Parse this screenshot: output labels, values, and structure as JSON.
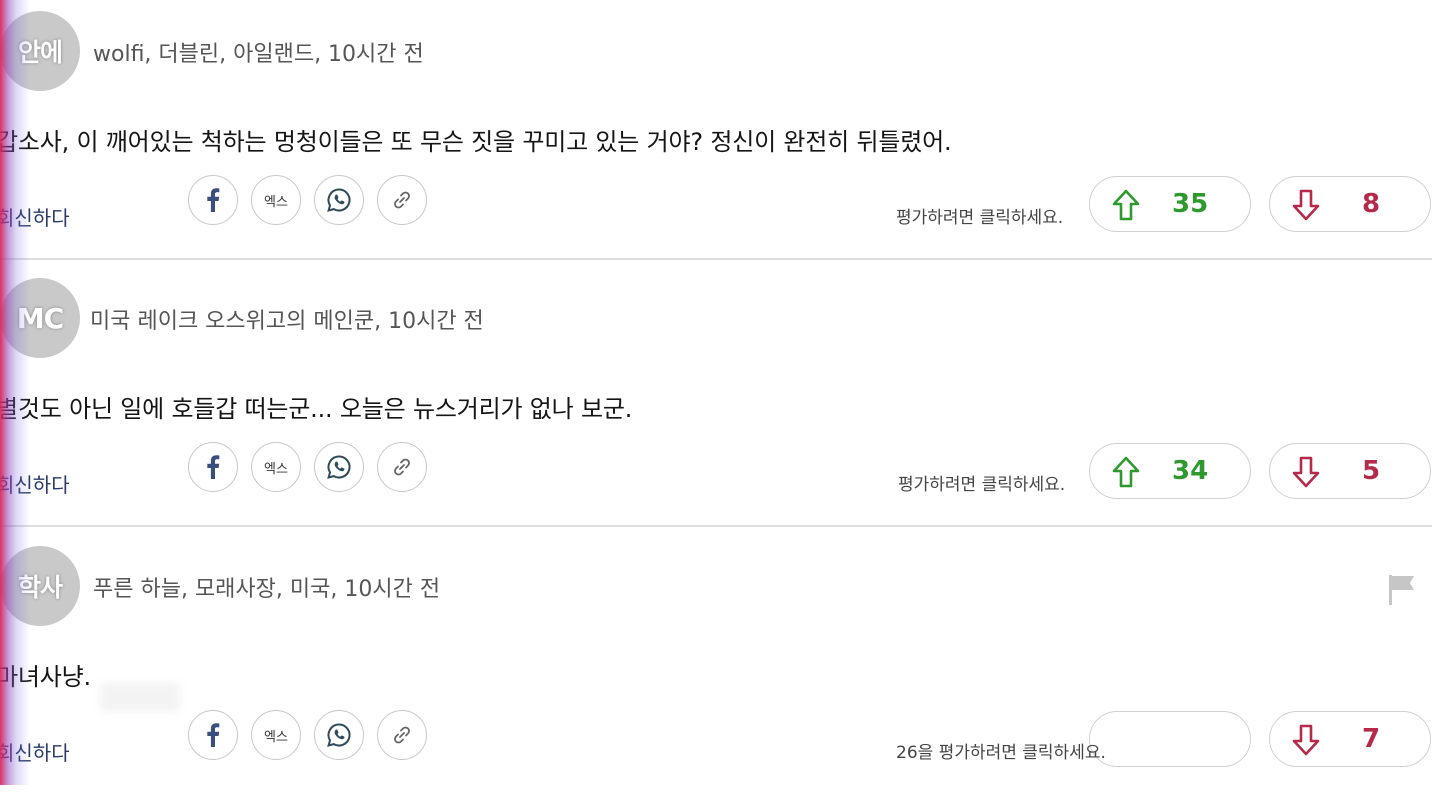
{
  "comments": [
    {
      "avatar": "안에",
      "meta": "wolfi, 더블린, 아일랜드, 10시간 전",
      "body": "갑소사, 이 깨어있는 척하는 멍청이들은 또 무슨 짓을 꾸미고 있는 거야? 정신이 완전히 뒤틀렸어.",
      "reply": "회신하다",
      "rate_label": "평가하려면 클릭하세요.",
      "upvotes": "35",
      "downvotes": "8"
    },
    {
      "avatar": "MC",
      "meta": "미국 레이크 오스위고의 메인쿤, 10시간 전",
      "body": "별것도 아닌 일에 호들갑 떠는군... 오늘은 뉴스거리가 없나 보군.",
      "reply": "회신하다",
      "rate_label": "평가하려면 클릭하세요.",
      "upvotes": "34",
      "downvotes": "5"
    },
    {
      "avatar": "학사",
      "meta": "푸른 하늘, 모래사장, 미국, 10시간 전",
      "body": "마녀사냥.",
      "reply": "회신하다",
      "rate_label": "26을 평가하려면 클릭하세요.",
      "upvotes": "",
      "downvotes": "7"
    }
  ],
  "share": {
    "x_label": "엑스"
  },
  "colors": {
    "up_accent": "#2e9a2e",
    "down_accent": "#b5294a",
    "avatar_bg": "#c9c9c9"
  },
  "icons": [
    "facebook-icon",
    "x-icon",
    "whatsapp-icon",
    "link-icon",
    "arrow-up-icon",
    "arrow-down-icon",
    "flag-icon"
  ]
}
